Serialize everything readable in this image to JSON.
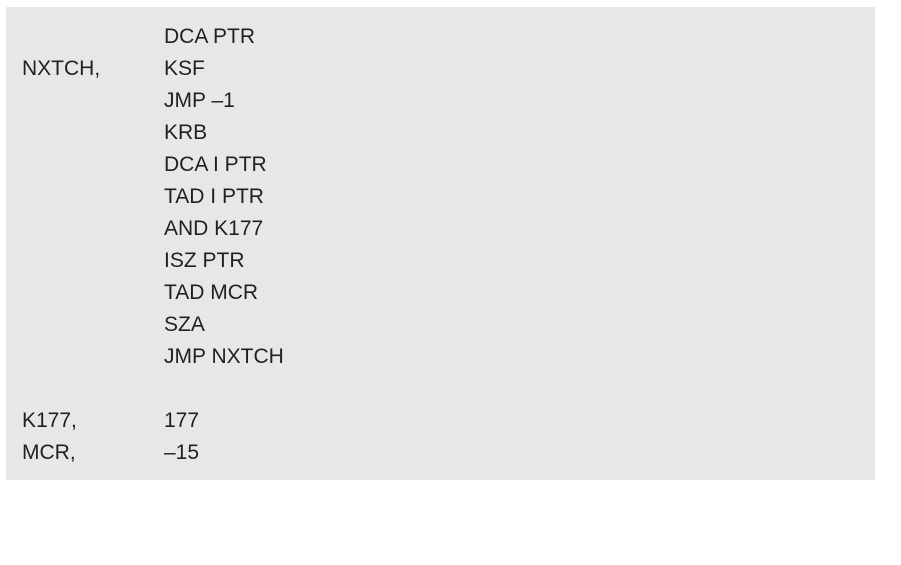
{
  "listing": {
    "lines": [
      {
        "label": "",
        "instruction": "DCA PTR"
      },
      {
        "label": "NXTCH,",
        "instruction": "KSF"
      },
      {
        "label": "",
        "instruction": "JMP –1"
      },
      {
        "label": "",
        "instruction": "KRB"
      },
      {
        "label": "",
        "instruction": "DCA I PTR"
      },
      {
        "label": "",
        "instruction": "TAD I PTR"
      },
      {
        "label": "",
        "instruction": "AND K177"
      },
      {
        "label": "",
        "instruction": "ISZ PTR"
      },
      {
        "label": "",
        "instruction": "TAD MCR"
      },
      {
        "label": "",
        "instruction": "SZA"
      },
      {
        "label": "",
        "instruction": "JMP NXTCH"
      },
      {
        "label": "",
        "instruction": ""
      },
      {
        "label": "K177,",
        "instruction": "177"
      },
      {
        "label": "MCR,",
        "instruction": "–15"
      }
    ]
  }
}
